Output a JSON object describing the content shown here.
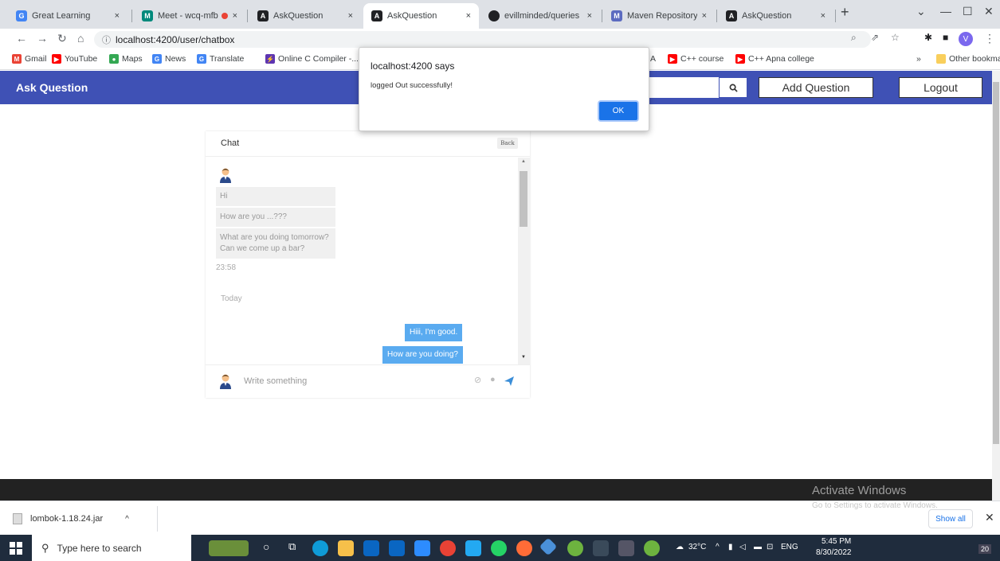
{
  "browser": {
    "tabs": [
      {
        "label": "Great Learning",
        "icon_text": "G",
        "color": "#4285f4"
      },
      {
        "label": "Meet - wcq-mfbc",
        "icon_text": "M",
        "color": "#00897b"
      },
      {
        "label": "AskQuestion",
        "icon_text": "A",
        "color": "#202124"
      },
      {
        "label": "AskQuestion",
        "icon_text": "A",
        "color": "#202124"
      },
      {
        "label": "evillminded/queries",
        "icon_text": "",
        "color": "#202124"
      },
      {
        "label": "Maven Repository: or",
        "icon_text": "M",
        "color": "#5c6bc0"
      },
      {
        "label": "AskQuestion",
        "icon_text": "A",
        "color": "#202124"
      }
    ],
    "tab_close": "×",
    "new_tab": "+",
    "url": "localhost:4200/user/chatbox",
    "profile_initial": "V",
    "bookmarks": [
      {
        "label": "Gmail",
        "color": "#ea4335",
        "icon_text": "M"
      },
      {
        "label": "YouTube",
        "color": "#ff0000",
        "icon_text": "▶"
      },
      {
        "label": "Maps",
        "color": "#34a853",
        "icon_text": "●"
      },
      {
        "label": "News",
        "color": "#4285f4",
        "icon_text": "G"
      },
      {
        "label": "Translate",
        "color": "#4285f4",
        "icon_text": "G"
      },
      {
        "label": "Online C Compiler -...",
        "color": "#5e35b1",
        "icon_text": "⚡"
      }
    ],
    "bookmarks_right": [
      {
        "label": "A",
        "color": "",
        "icon_text": ""
      },
      {
        "label": "C++ course",
        "color": "#ff0000",
        "icon_text": "▶"
      },
      {
        "label": "C++ Apna college",
        "color": "#ff0000",
        "icon_text": "▶"
      }
    ],
    "more_bookmarks": "»",
    "other_bookmarks": "Other bookmarks"
  },
  "navbar": {
    "brand": "Ask Question",
    "add_question": "Add Question",
    "logout": "Logout"
  },
  "chat": {
    "title": "Chat",
    "back": "Back",
    "incoming": [
      "Hi",
      "How are you ...???",
      "What are you doing tomorrow? Can we come up a bar?"
    ],
    "time": "23:58",
    "day": "Today",
    "outgoing": [
      "Hiii, I'm good.",
      "How are you doing?"
    ],
    "placeholder": "Write something"
  },
  "alert": {
    "title": "localhost:4200 says",
    "message": "logged Out successfully!",
    "ok": "OK"
  },
  "watermark": {
    "line1": "Activate Windows",
    "line2": "Go to Settings to activate Windows."
  },
  "downloads": {
    "file": "lombok-1.18.24.jar",
    "show_all": "Show all"
  },
  "taskbar": {
    "search": "Type here to search",
    "temp": "32°C",
    "lang": "ENG",
    "time": "5:45 PM",
    "date": "8/30/2022",
    "notifications": "20"
  }
}
